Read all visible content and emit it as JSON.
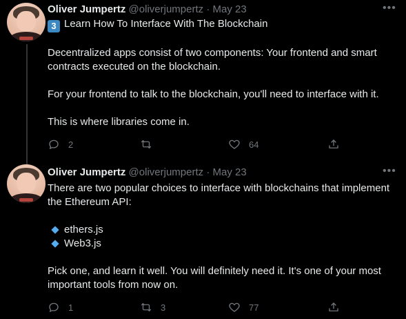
{
  "tweets": [
    {
      "author_name": "Oliver Jumpertz",
      "handle": "@oliverjumpertz",
      "separator": "·",
      "date": "May 23",
      "badge": "3",
      "paragraphs": [
        "Learn How To Interface With The Blockchain",
        "Decentralized apps consist of two components: Your frontend and smart contracts executed on the blockchain.",
        "For your frontend to talk to the blockchain, you'll need to interface with it.",
        "This is where libraries come in."
      ],
      "actions": {
        "reply": "2",
        "retweet": "",
        "like": "64"
      }
    },
    {
      "author_name": "Oliver Jumpertz",
      "handle": "@oliverjumpertz",
      "separator": "·",
      "date": "May 23",
      "paragraphs": [
        "There are two popular choices to interface with blockchains that implement the Ethereum API:",
        "Pick one, and learn it well. You will definitely need it. It's one of your most important tools from now on."
      ],
      "list_items": [
        "ethers.js",
        "Web3.js"
      ],
      "actions": {
        "reply": "1",
        "retweet": "3",
        "like": "77"
      }
    }
  ],
  "icons": {
    "more": "more-icon",
    "reply": "reply-icon",
    "retweet": "retweet-icon",
    "like": "heart-icon",
    "share": "share-icon",
    "list_bullet": "blue-diamond-icon",
    "badge": "keycap-three-icon"
  },
  "colors": {
    "background": "#000000",
    "text": "#e7e9ea",
    "muted": "#71767b",
    "thread_line": "#333639",
    "diamond": "#55acee",
    "badge": "#3b88c3"
  }
}
